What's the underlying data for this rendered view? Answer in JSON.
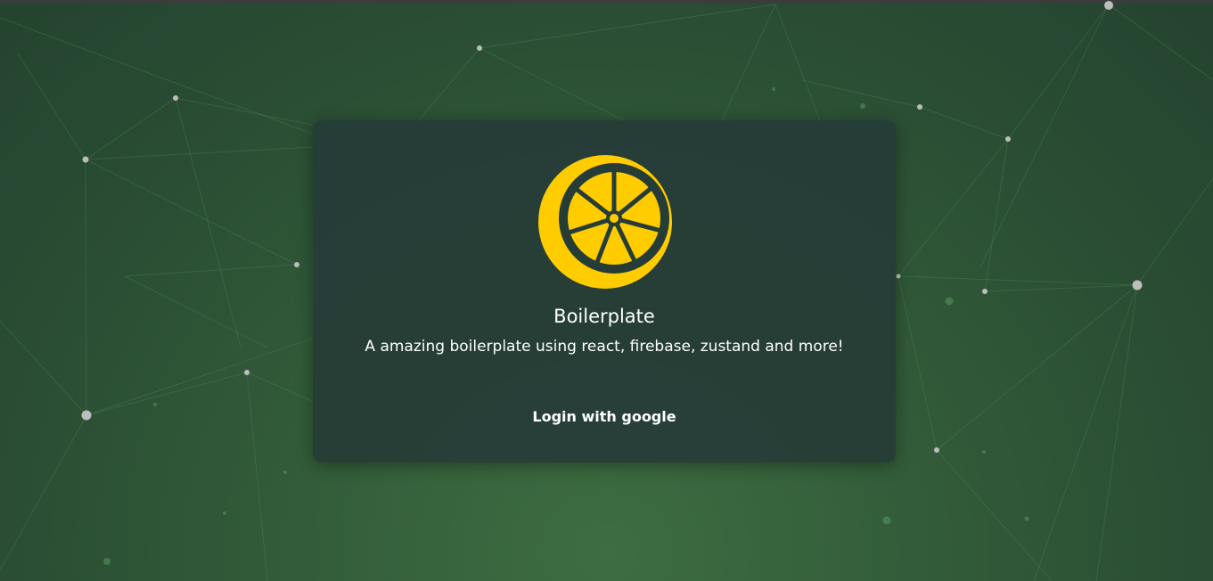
{
  "app": {
    "title": "Boilerplate",
    "subtitle": "A amazing boilerplate using react, firebase, zustand and more!",
    "login_label": "Login with google",
    "logo_icon": "lemon-slice-icon"
  },
  "colors": {
    "accent": "#ffcc00",
    "card_background": "#263c37",
    "page_background": "#335d3a",
    "text": "#ffffff"
  }
}
